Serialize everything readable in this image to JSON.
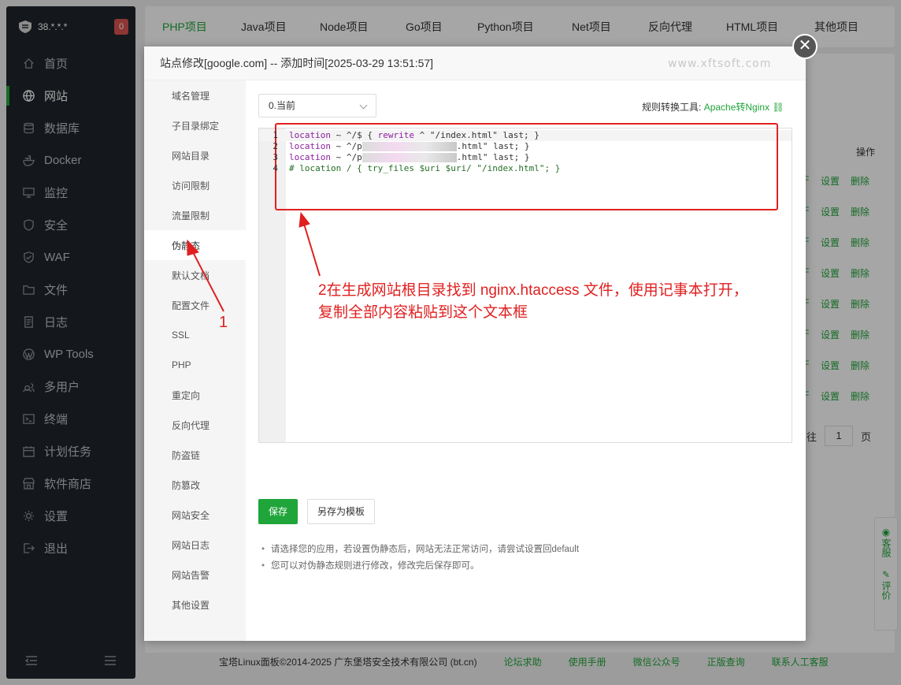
{
  "sidebar": {
    "server_name": "38.*.*.*",
    "badge": "0",
    "items": [
      {
        "label": "首页",
        "icon": "home-icon"
      },
      {
        "label": "网站",
        "icon": "globe-icon",
        "active": true
      },
      {
        "label": "数据库",
        "icon": "database-icon"
      },
      {
        "label": "Docker",
        "icon": "docker-icon"
      },
      {
        "label": "监控",
        "icon": "monitor-icon"
      },
      {
        "label": "安全",
        "icon": "shield-icon"
      },
      {
        "label": "WAF",
        "icon": "waf-shield-icon"
      },
      {
        "label": "文件",
        "icon": "folder-icon"
      },
      {
        "label": "日志",
        "icon": "log-icon"
      },
      {
        "label": "WP Tools",
        "icon": "wordpress-icon"
      },
      {
        "label": "多用户",
        "icon": "users-icon"
      },
      {
        "label": "终端",
        "icon": "terminal-icon"
      },
      {
        "label": "计划任务",
        "icon": "calendar-icon"
      },
      {
        "label": "软件商店",
        "icon": "store-icon"
      },
      {
        "label": "设置",
        "icon": "gear-icon"
      },
      {
        "label": "退出",
        "icon": "logout-icon"
      }
    ]
  },
  "top_tabs": [
    "PHP项目",
    "Java项目",
    "Node项目",
    "Go项目",
    "Python项目",
    "Net项目",
    "反向代理",
    "HTML项目",
    "其他项目"
  ],
  "site_table": {
    "op_header": "操作",
    "row_actions": [
      "F",
      "设置",
      "删除"
    ],
    "pager_prefix": "往",
    "page": "1",
    "pager_suffix": "页"
  },
  "footer": {
    "copyright": "宝塔Linux面板©2014-2025 广东堡塔安全技术有限公司 (bt.cn)",
    "links": [
      "论坛求助",
      "使用手册",
      "微信公众号",
      "正版查询",
      "联系人工客服"
    ]
  },
  "side_help": {
    "service": "客服",
    "rate": "评价"
  },
  "modal": {
    "title": "站点修改[google.com] -- 添加时间[2025-03-29 13:51:57]",
    "watermark": "www.xftsoft.com",
    "menu": [
      "域名管理",
      "子目录绑定",
      "网站目录",
      "访问限制",
      "流量限制",
      "伪静态",
      "默认文档",
      "配置文件",
      "SSL",
      "PHP",
      "重定向",
      "反向代理",
      "防盗链",
      "防篡改",
      "网站安全",
      "网站日志",
      "网站告警",
      "其他设置"
    ],
    "active_menu": "伪静态",
    "select_value": "0.当前",
    "tool_label": "规则转换工具:",
    "tool_link": "Apache转Nginx",
    "code_lines": [
      {
        "no": "1",
        "parts": [
          [
            "kw",
            "location"
          ],
          [
            "t",
            " ~ ^/$ { "
          ],
          [
            "kw",
            "rewrite"
          ],
          [
            "t",
            " ^ \"/index.html\" last; }"
          ]
        ]
      },
      {
        "no": "2",
        "parts": [
          [
            "kw",
            "location"
          ],
          [
            "t",
            " ~ ^/p"
          ],
          [
            "blur",
            ""
          ],
          [
            "t",
            ".html\" last; }"
          ]
        ]
      },
      {
        "no": "3",
        "parts": [
          [
            "kw",
            "location"
          ],
          [
            "t",
            " ~ ^/p"
          ],
          [
            "blur",
            ""
          ],
          [
            "t",
            ".html\" last; }"
          ]
        ]
      },
      {
        "no": "4",
        "parts": [
          [
            "cm",
            "# location / { try_files $uri $uri/ \"/index.html\"; }"
          ]
        ]
      }
    ],
    "save_label": "保存",
    "save_template_label": "另存为模板",
    "tips": [
      "请选择您的应用，若设置伪静态后，网站无法正常访问，请尝试设置回default",
      "您可以对伪静态规则进行修改，修改完后保存即可。"
    ]
  },
  "annotations": {
    "step1": "1",
    "step2_line1": "2在生成网站根目录找到 nginx.htaccess 文件，使用记事本打开，",
    "step2_line2": "复制全部内容粘贴到这个文本框"
  },
  "colors": {
    "accent": "#20a53a",
    "annotation": "#e02020",
    "sidebar_bg": "#20262b"
  }
}
